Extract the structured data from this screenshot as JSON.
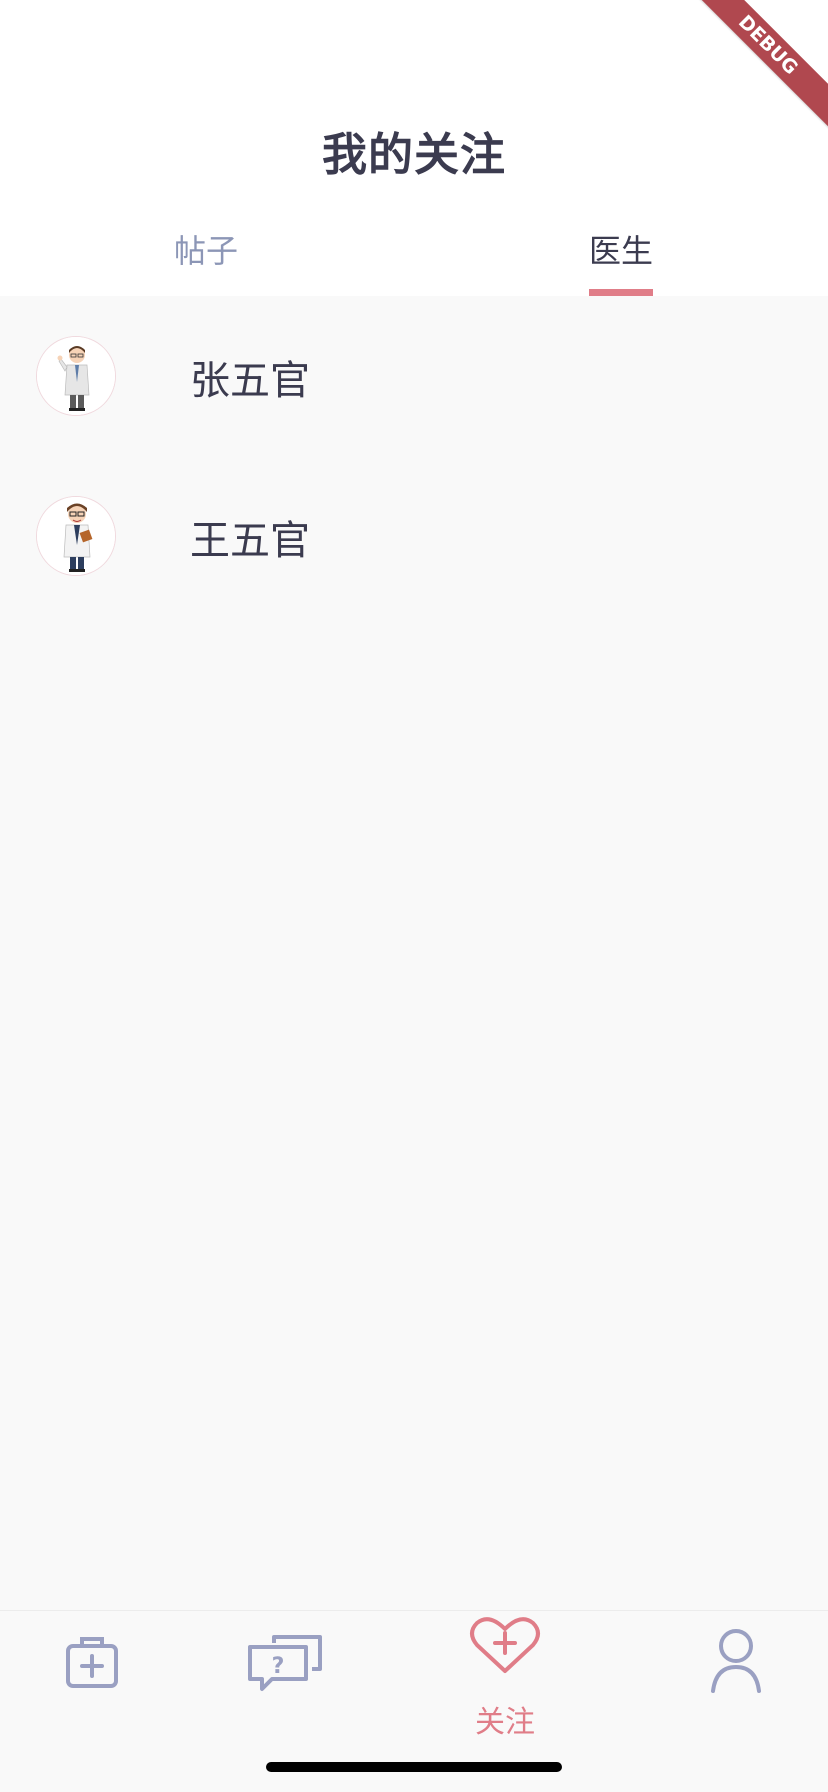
{
  "header": {
    "title": "我的关注",
    "debug_label": "DEBUG"
  },
  "tabs": [
    {
      "label": "帖子",
      "active": false
    },
    {
      "label": "医生",
      "active": true
    }
  ],
  "doctors": [
    {
      "name": "张五官",
      "avatar": "doctor-avatar-thumbs-up"
    },
    {
      "name": "王五官",
      "avatar": "doctor-avatar-clipboard"
    }
  ],
  "bottom_nav": {
    "items": [
      {
        "icon": "medical-kit-icon",
        "label": ""
      },
      {
        "icon": "question-chat-icon",
        "label": ""
      },
      {
        "icon": "heart-plus-icon",
        "label": "关注",
        "active": true
      },
      {
        "icon": "user-icon",
        "label": ""
      }
    ]
  },
  "colors": {
    "accent": "#e07d88",
    "inactive": "#8c96b6",
    "text": "#3b3b4f",
    "background": "#f9f9f9"
  }
}
